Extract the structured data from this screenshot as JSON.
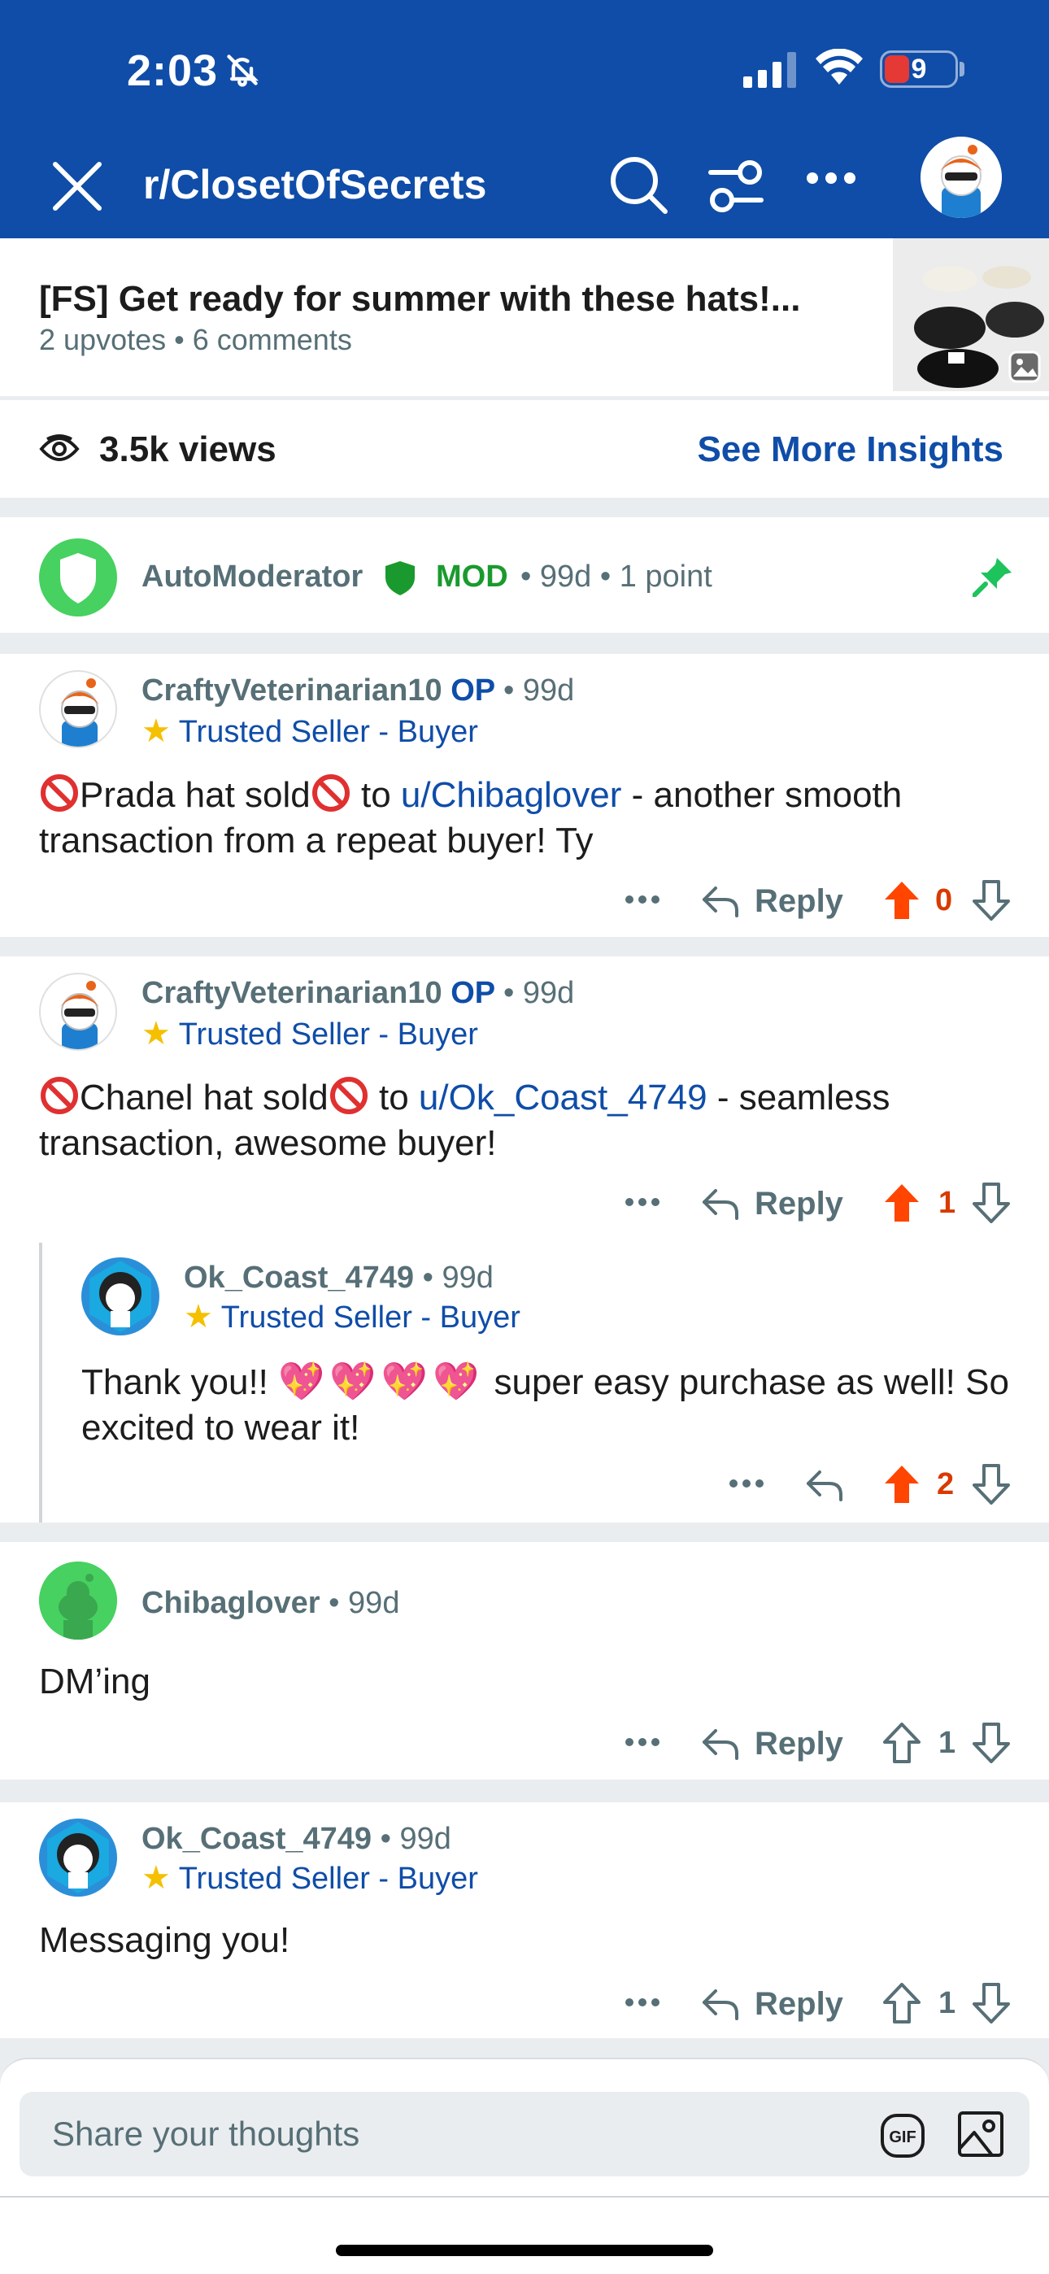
{
  "status_bar": {
    "time": "2:03",
    "battery": "9"
  },
  "nav": {
    "title": "r/ClosetOfSecrets"
  },
  "post": {
    "title": "[FS] Get ready for summer with these hats!...",
    "upvotes": "2 upvotes",
    "comments": "6 comments",
    "views": "3.5k views",
    "insights_label": "See More Insights"
  },
  "automod": {
    "username": "AutoModerator",
    "mod_label": "MOD",
    "age": "99d",
    "points": "1 point"
  },
  "comments": [
    {
      "username": "CraftyVeterinarian10",
      "op_label": "OP",
      "age": "99d",
      "flair": "Trusted Seller - Buyer",
      "text_a": "Prada hat sold",
      "text_b": " to ",
      "mention": "u/Chibaglover",
      "text_c": " - another smooth transaction from a repeat buyer! Ty",
      "reply_label": "Reply",
      "score": "0"
    },
    {
      "username": "CraftyVeterinarian10",
      "op_label": "OP",
      "age": "99d",
      "flair": "Trusted Seller - Buyer",
      "text_a": "Chanel hat sold",
      "text_b": " to ",
      "mention": "u/Ok_Coast_4749",
      "text_c": " - seamless transaction, awesome buyer!",
      "reply_label": "Reply",
      "score": "1"
    },
    {
      "username": "Ok_Coast_4749",
      "age": "99d",
      "flair": "Trusted Seller - Buyer",
      "text_a": "Thank you!!",
      "emoji": "💖💖💖💖",
      "text_b": " super easy purchase as well! So excited to wear it!",
      "score": "2"
    },
    {
      "username": "Chibaglover",
      "age": "99d",
      "text": "DM’ing",
      "reply_label": "Reply",
      "score": "1"
    },
    {
      "username": "Ok_Coast_4749",
      "age": "99d",
      "flair": "Trusted Seller - Buyer",
      "text": "Messaging you!",
      "reply_label": "Reply",
      "score": "1"
    }
  ],
  "composer": {
    "placeholder": "Share your thoughts",
    "gif_label": "GIF"
  },
  "colors": {
    "brand_blue": "#0f4da8",
    "upvote_orange": "#ff4500",
    "mod_green": "#1a9a2e",
    "meta_gray": "#576f76"
  },
  "icons": [
    "bell-off-icon",
    "signal-icon",
    "wifi-icon",
    "close-icon",
    "search-icon",
    "filter-icon",
    "more-icon",
    "eye-icon",
    "pin-icon",
    "shield-icon",
    "reply-icon",
    "upvote-icon",
    "downvote-icon",
    "gif-icon",
    "image-icon"
  ]
}
